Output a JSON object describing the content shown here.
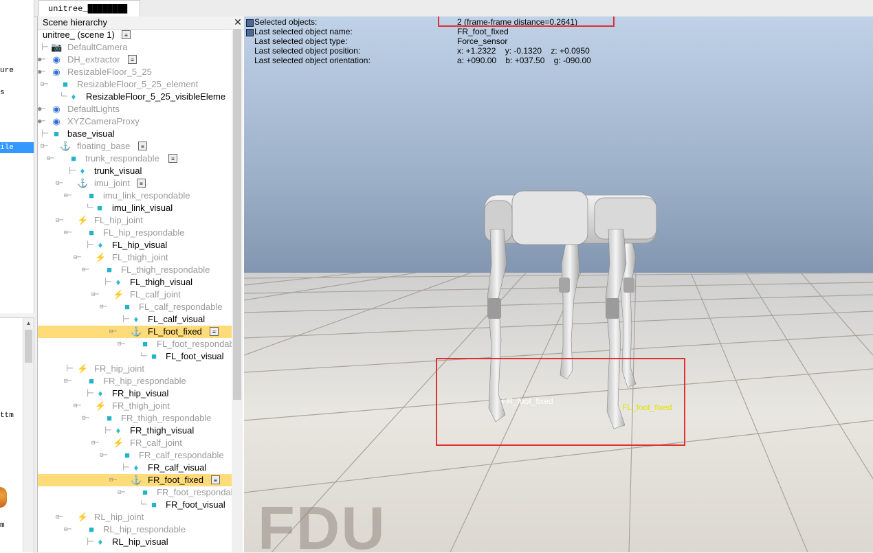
{
  "window": {
    "tab_label": "unitree_████████"
  },
  "left_browser": {
    "items": [
      {
        "text": "ure"
      },
      {
        "text": "s"
      },
      {
        "text": "ile"
      },
      {
        "text": "ttm"
      },
      {
        "text": "m"
      }
    ]
  },
  "hierarchy": {
    "title": "Scene hierarchy",
    "close_glyph": "✕",
    "scene_label": "unitree_ (scene 1)",
    "rows": [
      {
        "label": "DefaultCamera"
      },
      {
        "label": "DH_extractor"
      },
      {
        "label": "ResizableFloor_5_25"
      },
      {
        "label": "ResizableFloor_5_25_element"
      },
      {
        "label": "ResizableFloor_5_25_visibleEleme"
      },
      {
        "label": "DefaultLights"
      },
      {
        "label": "XYZCameraProxy"
      },
      {
        "label": "base_visual"
      },
      {
        "label": "floating_base"
      },
      {
        "label": "trunk_respondable"
      },
      {
        "label": "trunk_visual"
      },
      {
        "label": "imu_joint"
      },
      {
        "label": "imu_link_respondable"
      },
      {
        "label": "imu_link_visual"
      },
      {
        "label": "FL_hip_joint"
      },
      {
        "label": "FL_hip_respondable"
      },
      {
        "label": "FL_hip_visual"
      },
      {
        "label": "FL_thigh_joint"
      },
      {
        "label": "FL_thigh_respondable"
      },
      {
        "label": "FL_thigh_visual"
      },
      {
        "label": "FL_calf_joint"
      },
      {
        "label": "FL_calf_respondable"
      },
      {
        "label": "FL_calf_visual"
      },
      {
        "label": "FL_foot_fixed"
      },
      {
        "label": "FL_foot_respondable"
      },
      {
        "label": "FL_foot_visual"
      },
      {
        "label": "FR_hip_joint"
      },
      {
        "label": "FR_hip_respondable"
      },
      {
        "label": "FR_hip_visual"
      },
      {
        "label": "FR_thigh_joint"
      },
      {
        "label": "FR_thigh_respondable"
      },
      {
        "label": "FR_thigh_visual"
      },
      {
        "label": "FR_calf_joint"
      },
      {
        "label": "FR_calf_respondable"
      },
      {
        "label": "FR_calf_visual"
      },
      {
        "label": "FR_foot_fixed"
      },
      {
        "label": "FR_foot_respondable"
      },
      {
        "label": "FR_foot_visual"
      },
      {
        "label": "RL_hip_joint"
      },
      {
        "label": "RL_hip_respondable"
      },
      {
        "label": "RL_hip_visual"
      }
    ]
  },
  "info": {
    "selected_objects_label": "Selected objects:",
    "selected_objects_value": "2 (frame-frame distance=0.2641)",
    "last_name_label": "Last selected object name:",
    "last_name_value": "FR_foot_fixed",
    "last_type_label": "Last selected object type:",
    "last_type_value": "Force_sensor",
    "last_position_label": "Last selected object position:",
    "last_position_value": "x: +1.2322    y: -0.1320    z: +0.0950",
    "last_orientation_label": "Last selected object orientation:",
    "last_orientation_value": "a: +090.00    b: +037.50    g: -090.00"
  },
  "viewport": {
    "fr_foot_label": "FR_foot_fixed",
    "fl_foot_label": "FL_foot_fixed",
    "watermark": "FDU"
  },
  "colors": {
    "selection_highlight": "#ffdb7a",
    "annotation_red": "#e03030",
    "fl_label": "#e5e000"
  }
}
